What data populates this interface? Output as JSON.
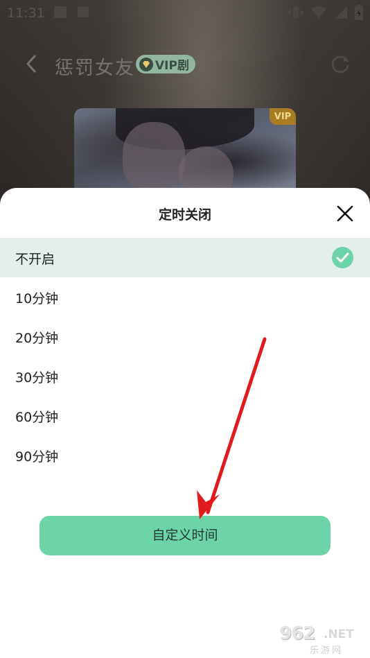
{
  "status_bar": {
    "time": "11:31",
    "icons": [
      "notification-square-icon",
      "app-square-icon",
      "vibrate-icon",
      "wifi-icon",
      "signal-icon",
      "battery-icon"
    ]
  },
  "header": {
    "back_icon": "chevron-left-icon",
    "title": "惩罚女友",
    "vip_badge": "VIP剧",
    "refresh_icon": "refresh-icon"
  },
  "poster": {
    "vip_tag": "VIP"
  },
  "sheet": {
    "title": "定时关闭",
    "close_icon": "close-icon",
    "options": [
      {
        "label": "不开启",
        "selected": true
      },
      {
        "label": "10分钟",
        "selected": false
      },
      {
        "label": "20分钟",
        "selected": false
      },
      {
        "label": "30分钟",
        "selected": false
      },
      {
        "label": "60分钟",
        "selected": false
      },
      {
        "label": "90分钟",
        "selected": false
      }
    ],
    "custom_button": "自定义时间"
  },
  "watermark": {
    "brand": "962",
    "suffix": ".NET",
    "sub": "乐游网"
  },
  "colors": {
    "accent": "#6cd4a8",
    "selected_row": "#e2efea",
    "vip_badge": "#93b6a0",
    "vip_tag": "#a77c22",
    "annotation_arrow": "#e01b1b"
  }
}
